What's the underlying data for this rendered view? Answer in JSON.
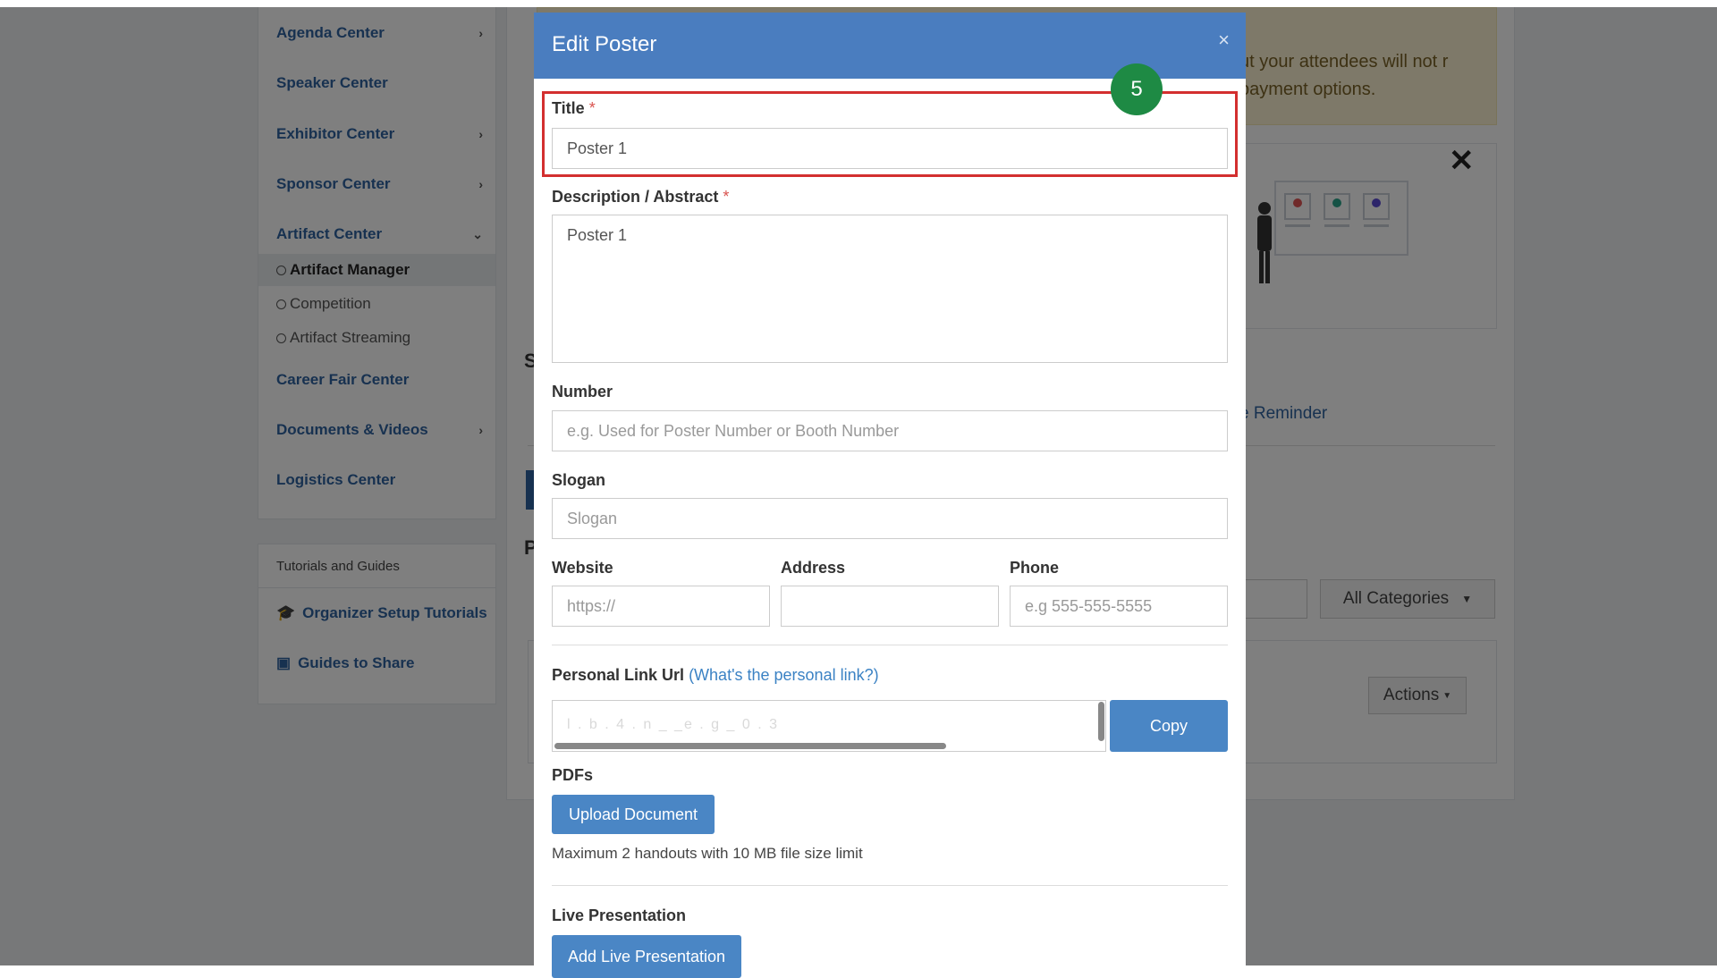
{
  "sidebar": {
    "items": [
      {
        "label": "Agenda Center",
        "chevron": "›"
      },
      {
        "label": "Speaker Center",
        "chevron": ""
      },
      {
        "label": "Exhibitor Center",
        "chevron": "›"
      },
      {
        "label": "Sponsor Center",
        "chevron": "›"
      },
      {
        "label": "Artifact Center",
        "chevron": "⌄"
      }
    ],
    "subitems": [
      {
        "label": "Artifact Manager"
      },
      {
        "label": "Competition"
      },
      {
        "label": "Artifact Streaming"
      }
    ],
    "items2": [
      {
        "label": "Career Fair Center",
        "chevron": ""
      },
      {
        "label": "Documents & Videos",
        "chevron": "›"
      },
      {
        "label": "Logistics Center",
        "chevron": ""
      }
    ]
  },
  "tutorials": {
    "heading": "Tutorials and Guides",
    "links": [
      {
        "label": "Organizer Setup Tutorials",
        "icon": "graduation-cap-icon"
      },
      {
        "label": "Guides to Share",
        "icon": "presentation-icon"
      }
    ]
  },
  "background": {
    "warning_text": "ut your attendees will not r payment options.",
    "reminder_link": "e Reminder",
    "category_select": "All Categories",
    "actions_button": "Actions",
    "peek_s": "S",
    "peek_p": "P"
  },
  "modal": {
    "title": "Edit Poster",
    "close": "×",
    "step_badge": "5",
    "required_mark": "*",
    "title_label": "Title",
    "title_value": "Poster 1",
    "description_label": "Description / Abstract",
    "description_value": "Poster 1",
    "number_label": "Number",
    "number_placeholder": "e.g. Used for Poster Number or Booth Number",
    "slogan_label": "Slogan",
    "slogan_placeholder": "Slogan",
    "website_label": "Website",
    "website_placeholder": "https://",
    "address_label": "Address",
    "address_value": "",
    "phone_label": "Phone",
    "phone_placeholder": "e.g 555-555-5555",
    "personal_link_label": "Personal Link Url",
    "personal_link_help": "(What's the personal link?)",
    "personal_link_value": "l  .  b  .  4  .  n  _  _e  .  g  _  0  .  3",
    "copy_button": "Copy",
    "pdfs_label": "PDFs",
    "upload_button": "Upload Document",
    "upload_note": "Maximum 2 handouts with 10 MB file size limit",
    "live_label": "Live Presentation",
    "live_button": "Add Live Presentation"
  },
  "colors": {
    "header": "#4a7dbf",
    "link": "#2f63a0",
    "highlight": "#d32f2f",
    "badge": "#1e8a44"
  }
}
